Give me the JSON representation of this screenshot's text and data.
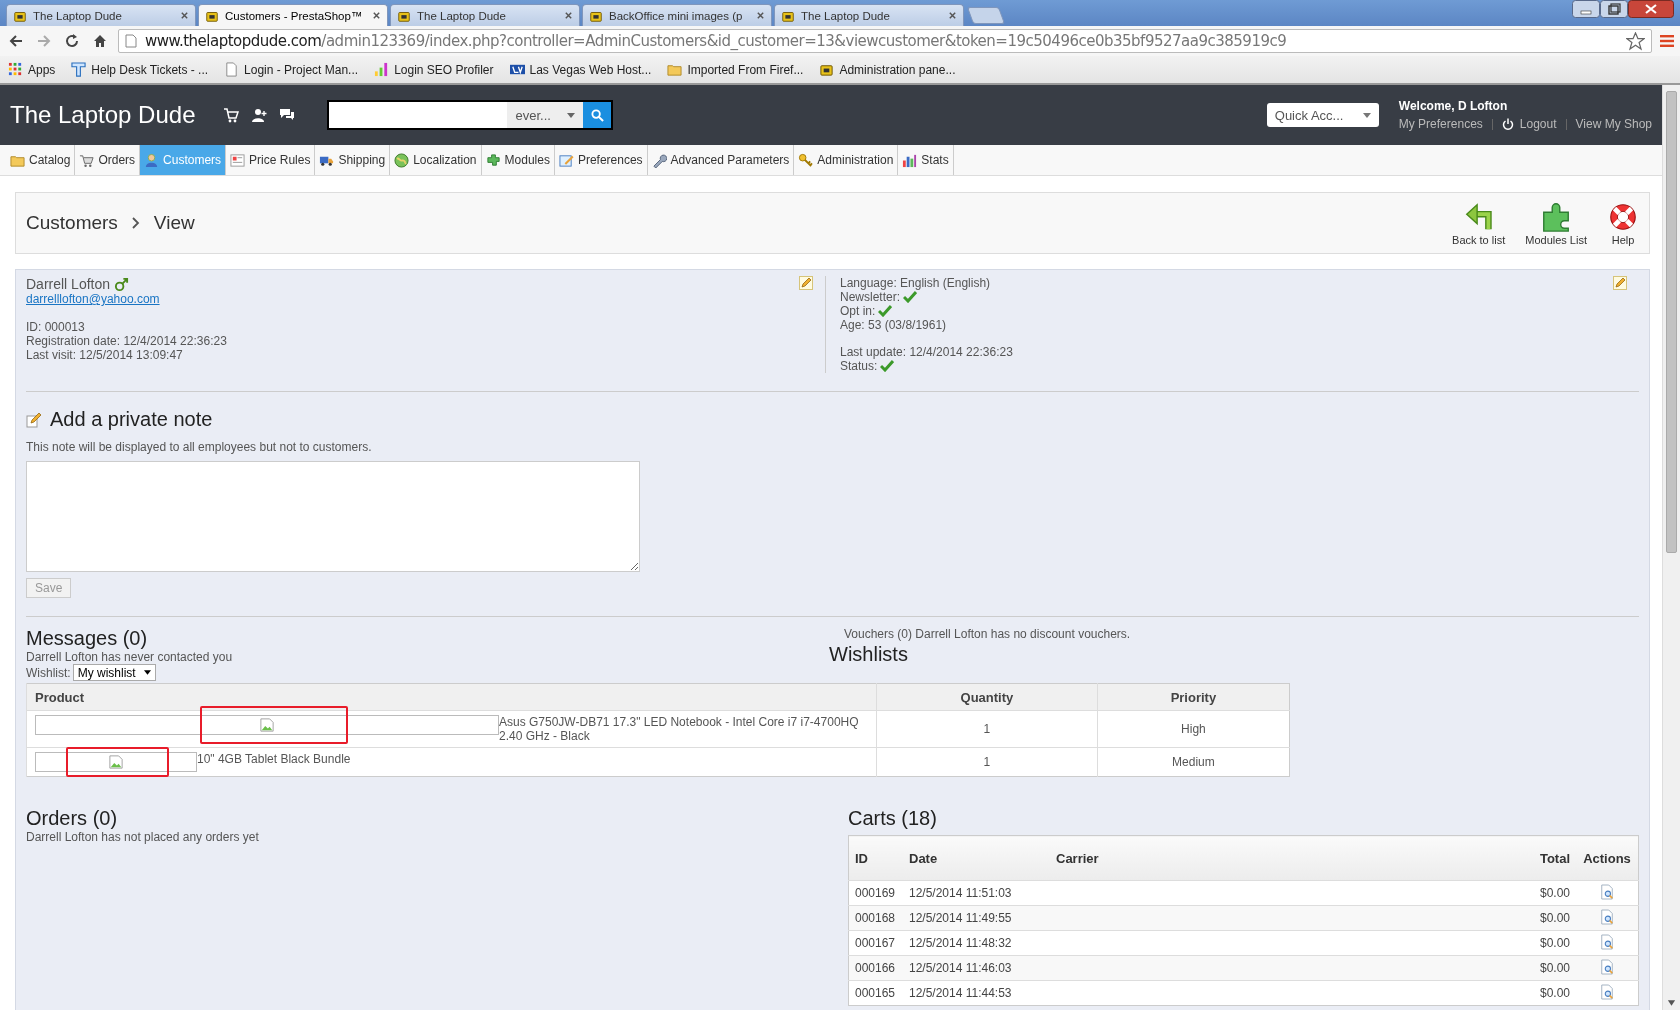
{
  "browser": {
    "tabs": [
      {
        "title": "The Laptop Dude",
        "selected": false
      },
      {
        "title": "Customers - PrestaShop™",
        "selected": true
      },
      {
        "title": "The Laptop Dude",
        "selected": false
      },
      {
        "title": "BackOffice mini images (p",
        "selected": false
      },
      {
        "title": "The Laptop Dude",
        "selected": false
      }
    ],
    "url": {
      "host": "www.thelaptopdude.com",
      "path": "/admin123369/index.php?controller=AdminCustomers&id_customer=13&viewcustomer&token=19c50496ce0b35bf9527aa9c385919c9"
    },
    "bookmarks": [
      "Apps",
      "Help Desk Tickets - ...",
      "Login - Project Man...",
      "Login SEO Profiler",
      "Las Vegas Web Host...",
      "Imported From Firef...",
      "Administration pane..."
    ]
  },
  "header": {
    "logo": "The Laptop Dude",
    "search_scope": "ever...",
    "quick_access": "Quick Acc...",
    "welcome": "Welcome, D Lofton",
    "links": [
      "My Preferences",
      "Logout",
      "View My Shop"
    ]
  },
  "nav": [
    {
      "label": "Catalog",
      "selected": false
    },
    {
      "label": "Orders",
      "selected": false
    },
    {
      "label": "Customers",
      "selected": true
    },
    {
      "label": "Price Rules",
      "selected": false
    },
    {
      "label": "Shipping",
      "selected": false
    },
    {
      "label": "Localization",
      "selected": false
    },
    {
      "label": "Modules",
      "selected": false
    },
    {
      "label": "Preferences",
      "selected": false
    },
    {
      "label": "Advanced Parameters",
      "selected": false
    },
    {
      "label": "Administration",
      "selected": false
    },
    {
      "label": "Stats",
      "selected": false
    }
  ],
  "page": {
    "breadcrumb": [
      "Customers",
      "View"
    ],
    "toolbar": [
      "Back to list",
      "Modules List",
      "Help"
    ]
  },
  "customer": {
    "name": "Darrell Lofton",
    "email": "darrelllofton@yahoo.com",
    "details": [
      "ID: 000013",
      "Registration date: 12/4/2014 22:36:23",
      "Last visit: 12/5/2014 13:09:47"
    ],
    "language": "Language: English (English)",
    "flags": [
      {
        "label": "Newsletter:",
        "checked": true
      },
      {
        "label": "Opt in:",
        "checked": true
      }
    ],
    "age": "Age: 53 (03/8/1961)",
    "last_update": "Last update: 12/4/2014 22:36:23",
    "status": {
      "label": "Status:",
      "checked": true
    }
  },
  "private_note": {
    "title": "Add a private note",
    "hint": "This note will be displayed to all employees but not to customers.",
    "save": {
      "label": "Save",
      "disabled": true
    }
  },
  "messages": {
    "title": "Messages (0)",
    "text": "Darrell Lofton has never contacted you"
  },
  "vouchers": "Vouchers (0) Darrell Lofton has no discount vouchers.",
  "wishlists": {
    "title": "Wishlists",
    "selector_label": "Wishlist:",
    "selected_list": "My wishlist",
    "columns": [
      "Product",
      "Quantity",
      "Priority"
    ],
    "rows": [
      {
        "product": "Asus G750JW-DB71 17.3\" LED Notebook - Intel Core i7 i7-4700HQ 2.40 GHz - Black",
        "quantity": "1",
        "priority": "High"
      },
      {
        "product": "10\" 4GB Tablet Black Bundle",
        "quantity": "1",
        "priority": "Medium"
      }
    ]
  },
  "orders": {
    "title": "Orders (0)",
    "text": "Darrell Lofton has not placed any orders yet"
  },
  "carts": {
    "title": "Carts (18)",
    "columns": [
      "ID",
      "Date",
      "Carrier",
      "Total",
      "Actions"
    ],
    "rows": [
      {
        "id": "000169",
        "date": "12/5/2014 11:51:03",
        "total": "$0.00"
      },
      {
        "id": "000168",
        "date": "12/5/2014 11:49:55",
        "total": "$0.00"
      },
      {
        "id": "000167",
        "date": "12/5/2014 11:48:32",
        "total": "$0.00"
      },
      {
        "id": "000166",
        "date": "12/5/2014 11:46:03",
        "total": "$0.00"
      },
      {
        "id": "000165",
        "date": "12/5/2014 11:44:53",
        "total": "$0.00"
      }
    ]
  }
}
